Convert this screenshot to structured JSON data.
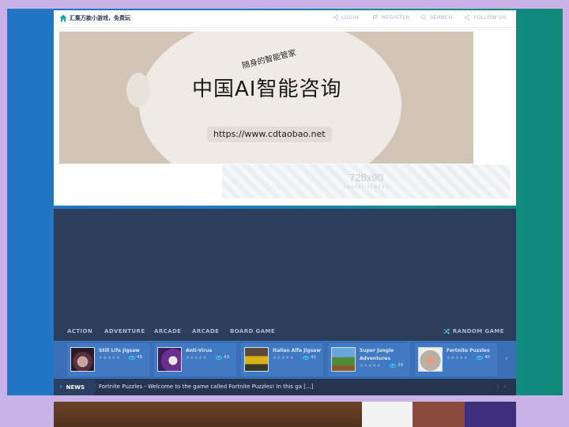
{
  "header": {
    "site_title": "汇集万款小游戏，免费玩",
    "links": [
      {
        "label": "LOGIN",
        "icon": "login-icon"
      },
      {
        "label": "REGISTER",
        "icon": "register-icon"
      },
      {
        "label": "SEARCH",
        "icon": "search-icon"
      },
      {
        "label": "FOLLOW US",
        "icon": "share-icon"
      }
    ]
  },
  "banner": {
    "subtitle": "随身的智能管家",
    "title": "中国AI智能咨询",
    "url": "https://www.cdtaobao.net"
  },
  "ad": {
    "size": "728x90",
    "label": "ADVERTISEMENT"
  },
  "categories": [
    "ACTION",
    "ADVENTURE",
    "ARCADE",
    "ARCADE",
    "BOARD GAME"
  ],
  "random_game_label": "RANDOM GAME",
  "games": [
    {
      "name": "Still Life Jigsaw",
      "views": "48",
      "stars": "★★★★★"
    },
    {
      "name": "Anti-Virus",
      "views": "43",
      "stars": "★★★★★"
    },
    {
      "name": "Italian Alfa Jigsaw",
      "views": "41",
      "stars": "★★★★★"
    },
    {
      "name": "Super Jungle Adventures",
      "views": "29",
      "stars": "★★★★★"
    },
    {
      "name": "Fortnite Puzzles",
      "views": "40",
      "stars": "★★★★★"
    }
  ],
  "news": {
    "label": "NEWS",
    "text": "Fortnite Puzzles - Welcome to the game called Fortnite Puzzles! In this ga [...]"
  },
  "colors": {
    "page_background": "#c9b3e6",
    "panel": "#2c3e5b",
    "strip": "#3a6fb5",
    "accent_cyan": "#3fd1e6"
  }
}
